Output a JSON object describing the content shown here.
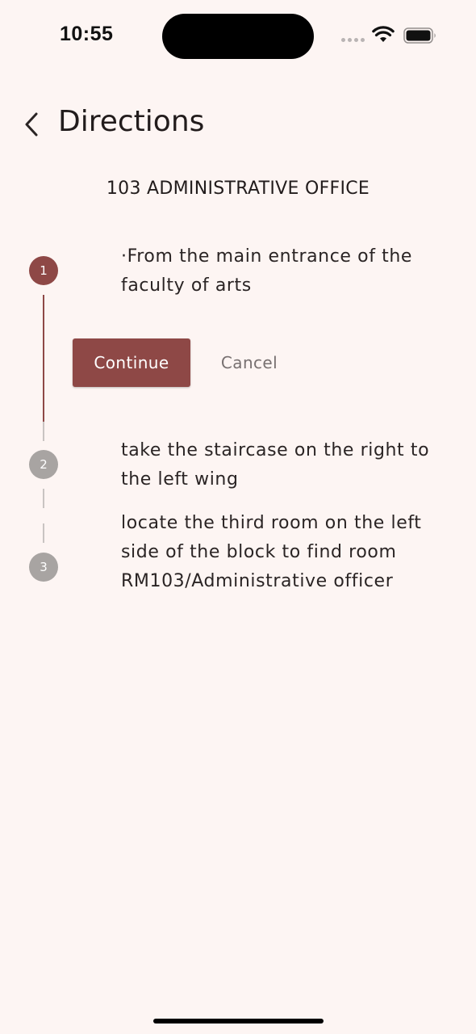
{
  "status_bar": {
    "time": "10:55"
  },
  "header": {
    "title": "Directions",
    "back_icon": "chevron-left-icon"
  },
  "destination": "103 ADMINISTRATIVE OFFICE",
  "steps": [
    {
      "number": "1",
      "text": "·From the main entrance of the faculty of arts",
      "state": "active"
    },
    {
      "number": "2",
      "text": "take the staircase on the right to the left wing",
      "state": "inactive"
    },
    {
      "number": "3",
      "text": "locate the third room on the left side of the block to find room RM103/Administrative officer",
      "state": "inactive"
    }
  ],
  "actions": {
    "continue_label": "Continue",
    "cancel_label": "Cancel"
  },
  "colors": {
    "accent": "#8e4846",
    "background": "#fdf5f3",
    "inactive": "#a8a4a2"
  }
}
